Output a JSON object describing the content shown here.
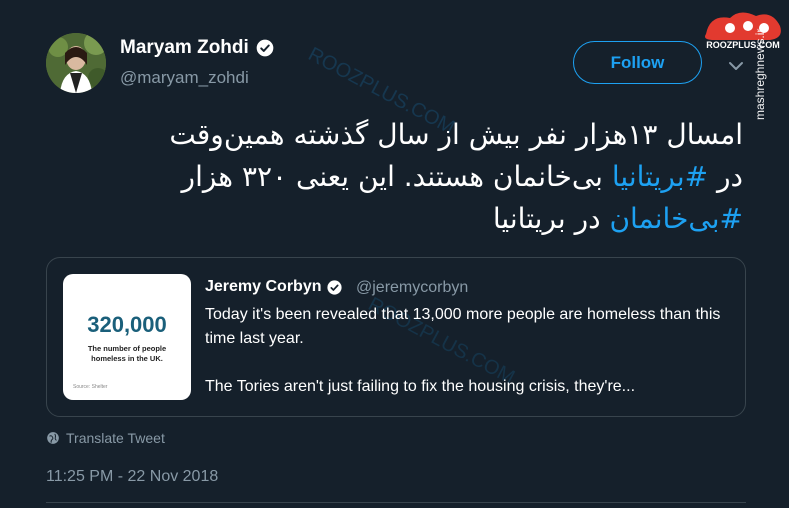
{
  "author": {
    "name": "Maryam Zohdi",
    "handle": "@maryam_zohdi"
  },
  "follow_label": "Follow",
  "side_watermark": "mashreghnews.ir",
  "logo": {
    "text": "ROOZPLUS.COM"
  },
  "tweet": {
    "line1": "امسال ۱۳هزار نفر بیش از سال گذشته همین‌وقت",
    "line2_pre": "در ",
    "line2_hashtag": "#بریتانیا",
    "line2_post": " بی‌خانمان هستند. این یعنی ۳۲۰ هزار",
    "line3_hashtag": "#بی‌خانمان",
    "line3_post": " در بریتانیا"
  },
  "quoted": {
    "name": "Jeremy Corbyn",
    "handle": "@jeremycorbyn",
    "paragraph1": "Today it's been revealed that 13,000 more people are homeless than this time last year.",
    "paragraph2": "The Tories aren't just failing to fix the housing crisis, they're...",
    "image": {
      "number": "320,000",
      "caption": "The number of people homeless in the UK.",
      "source": "Source: Shelter"
    }
  },
  "translate_label": "Translate Tweet",
  "timestamp": "11:25 PM - 22 Nov 2018",
  "colors": {
    "background": "#15202b",
    "accent": "#1da1f2",
    "muted": "#8899a6",
    "border": "#38444d"
  },
  "icons": {
    "verified": "verified-badge-icon",
    "chevron": "chevron-down-icon",
    "globe": "globe-icon"
  }
}
